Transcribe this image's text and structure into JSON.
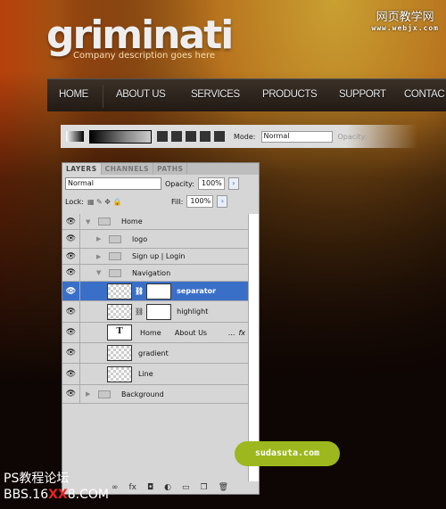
{
  "header": {
    "logo": "griminati",
    "tagline": "Company description goes here"
  },
  "watermarks": {
    "site_cn": "网页教学网",
    "site_url": "www.webjx.com",
    "forum_cn": "PS教程论坛",
    "forum_url_a": "BBS.16",
    "forum_url_b": "XX",
    "forum_url_c": "8.COM",
    "bubble": "sudasuta.com"
  },
  "nav": [
    "HOME",
    "ABOUT US",
    "SERVICES",
    "PRODUCTS",
    "SUPPORT",
    "CONTAC"
  ],
  "toolbar": {
    "mode_label": "Mode:",
    "mode_value": "Normal",
    "opacity_label": "Opacity:"
  },
  "panel": {
    "tabs": [
      "LAYERS",
      "CHANNELS",
      "PATHS"
    ],
    "blend": "Normal",
    "opacity_label": "Opacity:",
    "opacity": "100%",
    "lock_label": "Lock:",
    "fill_label": "Fill:",
    "fill": "100%",
    "layers": [
      {
        "name": "Home",
        "type": "group",
        "open": true
      },
      {
        "name": "logo",
        "type": "group"
      },
      {
        "name": "Sign up  |  Login",
        "type": "group"
      },
      {
        "name": "Navigation",
        "type": "group",
        "open": true
      },
      {
        "name": "separator",
        "type": "smart",
        "selected": true
      },
      {
        "name": "highlight",
        "type": "smart"
      },
      {
        "name": "Home      About Us",
        "type": "text",
        "suffix": "...",
        "fx": "fx"
      },
      {
        "name": "gradient",
        "type": "smart"
      },
      {
        "name": "Line",
        "type": "pixel"
      },
      {
        "name": "Background",
        "type": "group"
      }
    ]
  }
}
